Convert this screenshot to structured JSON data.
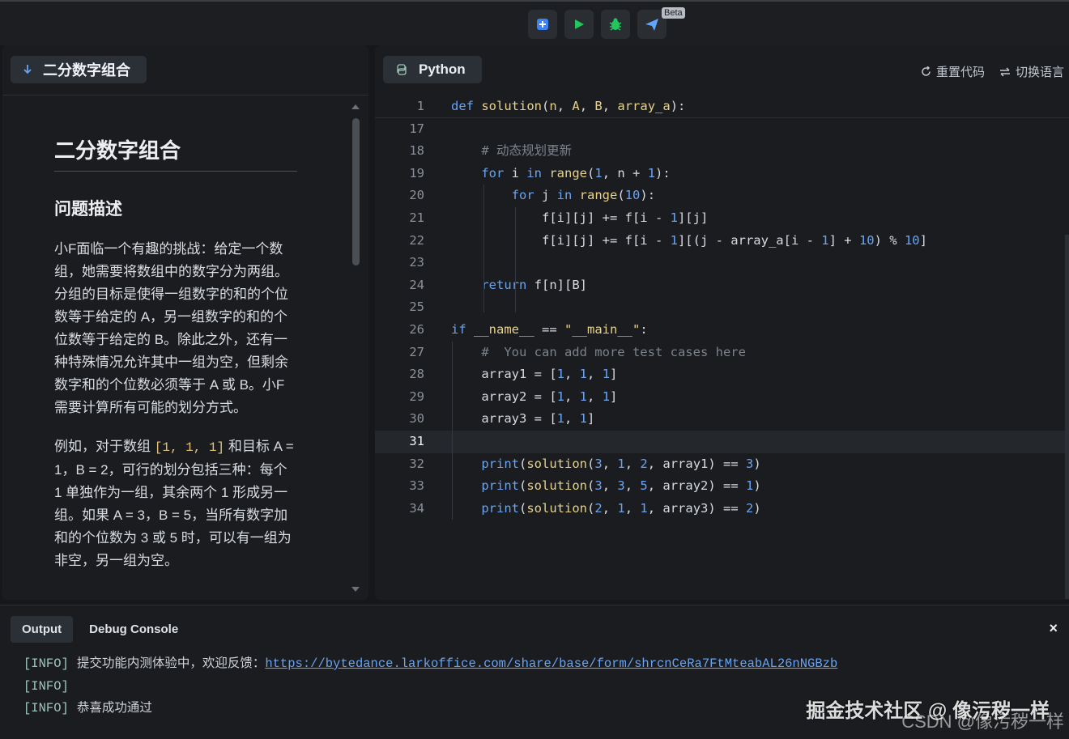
{
  "toolbar": {
    "beta_label": "Beta",
    "buttons": [
      {
        "icon": "submit-icon",
        "color": "#3b82f6"
      },
      {
        "icon": "run-play-icon",
        "color": "#22c55e"
      },
      {
        "icon": "debug-bug-icon",
        "color": "#22c55e"
      },
      {
        "icon": "send-plane-icon",
        "color": "#60a5fa"
      }
    ]
  },
  "problem": {
    "tab_label": "二分数字组合",
    "title": "二分数字组合",
    "section_heading": "问题描述",
    "paragraph1": "小F面临一个有趣的挑战：给定一个数组，她需要将数组中的数字分为两组。分组的目标是使得一组数字的和的个位数等于给定的 A，另一组数字的和的个位数等于给定的 B。除此之外，还有一种特殊情况允许其中一组为空，但剩余数字和的个位数必须等于 A 或 B。小F需要计算所有可能的划分方式。",
    "paragraph2_prefix": "例如，对于数组 ",
    "paragraph2_code": "[1, 1, 1]",
    "paragraph2_suffix": " 和目标 A = 1，B = 2，可行的划分包括三种：每个 1 单独作为一组，其余两个 1 形成另一组。如果 A = 3，B = 5，当所有数字加和的个位数为 3 或 5 时，可以有一组为非空，另一组为空。"
  },
  "editor": {
    "language": "Python",
    "reset_label": "重置代码",
    "switch_label": "切换语言",
    "current_line": "31"
  },
  "console": {
    "tabs": [
      "Output",
      "Debug Console"
    ],
    "close_label": "×",
    "logs": [
      {
        "tag": "[INFO]",
        "text": "提交功能内测体验中，欢迎反馈：",
        "link": "https://bytedance.larkoffice.com/share/base/form/shrcnCeRa7FtMteabAL26nNGBzb"
      },
      {
        "tag": "[INFO]",
        "text": "",
        "link": ""
      },
      {
        "tag": "[INFO]",
        "text": "恭喜成功通过",
        "link": ""
      }
    ]
  },
  "watermark": {
    "line1": "掘金技术社区 @ 像污秽一样",
    "line2": "CSDN @像污秽一样"
  }
}
